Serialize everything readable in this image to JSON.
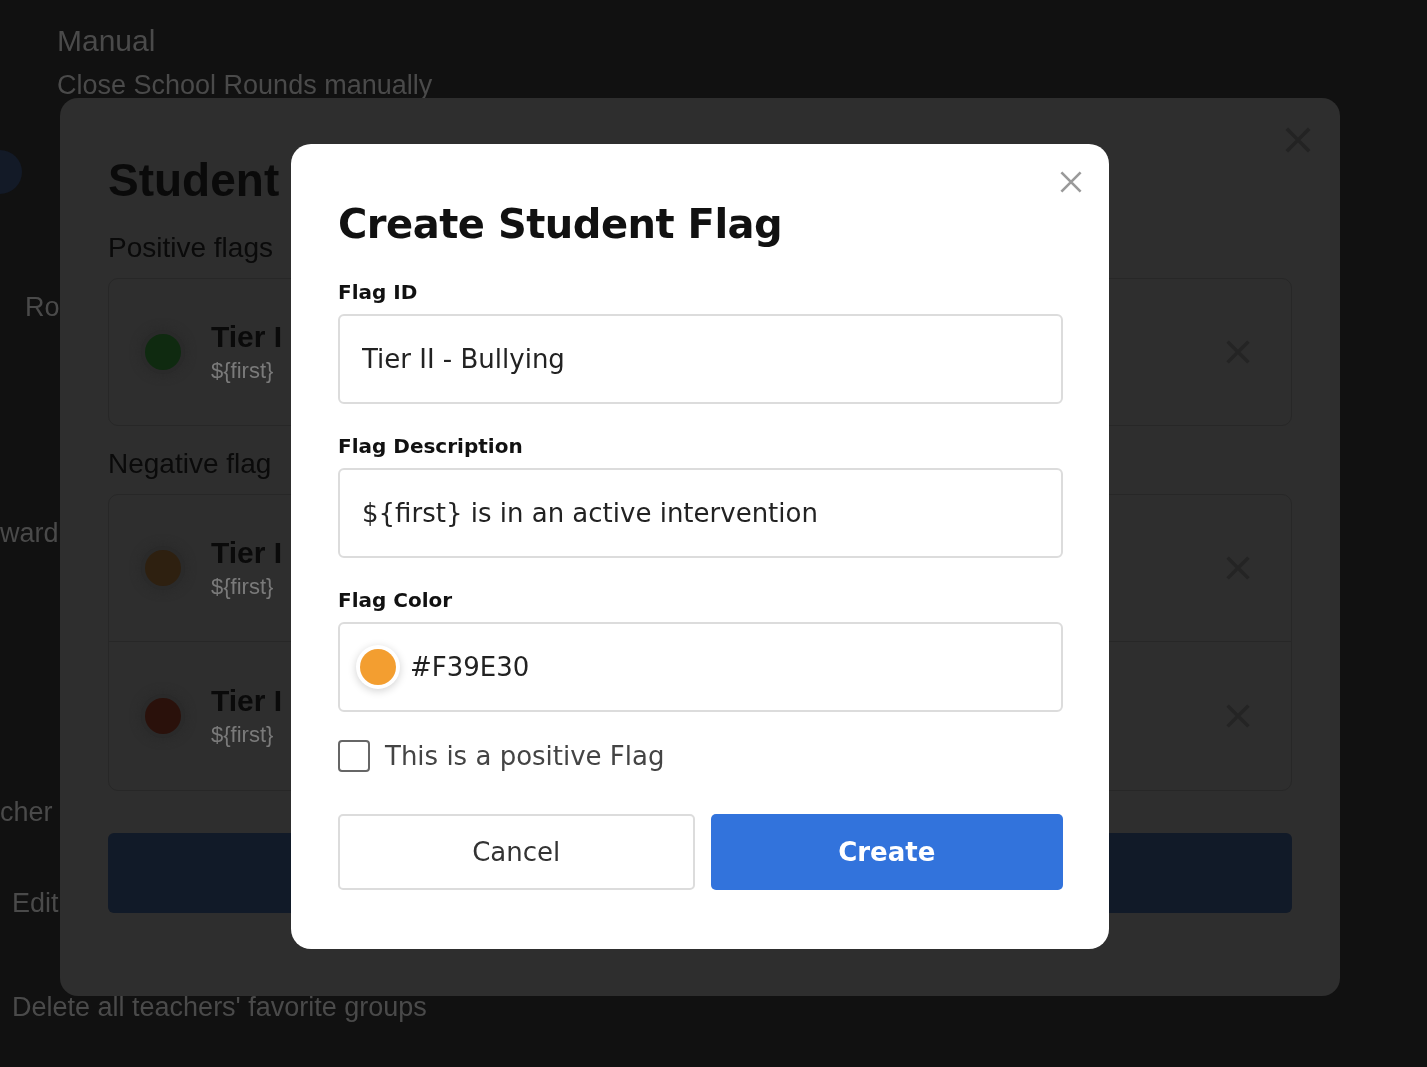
{
  "background_page": {
    "title": "Manual",
    "subtitle": "Close School Rounds manually",
    "texts": [
      "Ro",
      "ward",
      "cher",
      "Edit",
      "Delete all teachers' favorite groups"
    ]
  },
  "students_modal": {
    "title": "Student",
    "sections": [
      {
        "heading": "Positive flags",
        "flags": [
          {
            "name": "Tier I",
            "description": "${first}",
            "color": "#0f2a10"
          }
        ]
      },
      {
        "heading": "Negative flag",
        "flags": [
          {
            "name": "Tier I",
            "description": "${first}",
            "color": "#2e2010"
          },
          {
            "name": "Tier I",
            "description": "${first}",
            "color": "#2a110b"
          }
        ]
      }
    ]
  },
  "create_dialog": {
    "title": "Create Student Flag",
    "fields": [
      {
        "label": "Flag ID",
        "value": "Tier II - Bullying",
        "kind": "text"
      },
      {
        "label": "Flag Description",
        "value": "${first} is in an active intervention",
        "kind": "text"
      },
      {
        "label": "Flag Color",
        "value": "#F39E30",
        "kind": "color",
        "color": "#f39e30"
      }
    ],
    "positive": {
      "label": "This is a positive Flag",
      "checked": false
    },
    "buttons": [
      {
        "label": "Cancel",
        "kind": "secondary"
      },
      {
        "label": "Create",
        "kind": "primary"
      }
    ]
  }
}
